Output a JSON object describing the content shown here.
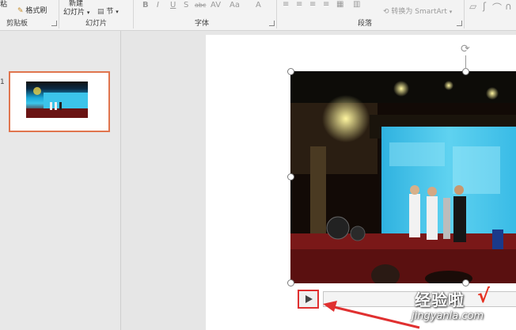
{
  "ribbon": {
    "clipboard": {
      "top_fragment": "粘",
      "format_painter": "格式刷",
      "group_label": "剪贴板"
    },
    "slides": {
      "new_top": "新建",
      "new_bottom": "幻灯片",
      "section": "节",
      "group_label": "幻灯片"
    },
    "font": {
      "bold": "B",
      "italic": "I",
      "underline": "U",
      "shadow": "S",
      "strike": "abc",
      "spacing": "AV",
      "case": "Aa",
      "color": "A",
      "group_label": "字体"
    },
    "paragraph": {
      "smartart": "转换为 SmartArt",
      "group_label": "段落"
    }
  },
  "panel": {
    "slide_number": "1"
  },
  "watermark": {
    "text": "经验啦",
    "check": "√",
    "url": "jingyanla.com"
  },
  "colors": {
    "selection": "#e0754e",
    "highlight": "#e03030",
    "arrow": "#e03030"
  }
}
